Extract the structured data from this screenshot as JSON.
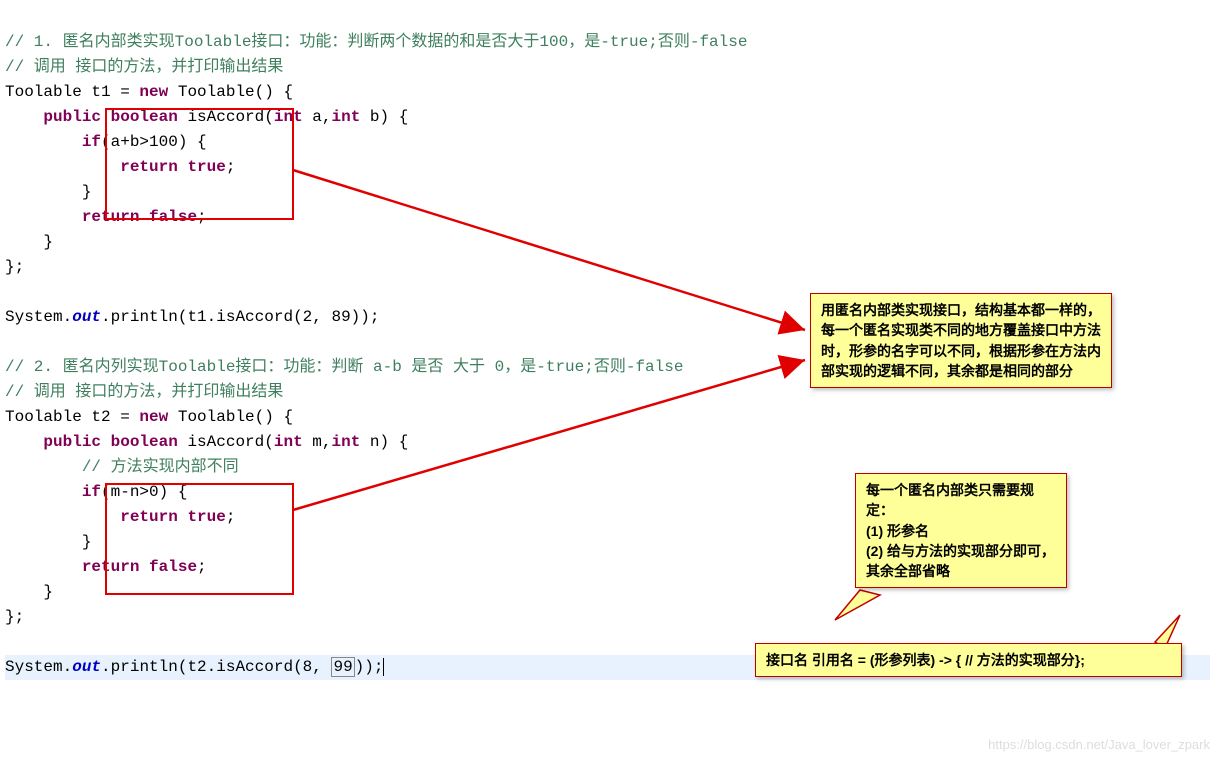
{
  "comments": {
    "c1a": "// 1. 匿名内部类实现Toolable接口：功能：判断两个数据的和是否大于100，是-true;否则-false",
    "c1b": "// 调用 接口的方法，并打印输出结果",
    "c2a": "// 2. 匿名内列实现Toolable接口：功能：判断 a-b 是否 大于 0，是-true;否则-false",
    "c2b": "// 调用 接口的方法，并打印输出结果",
    "c3": "// 方法实现内部不同"
  },
  "code": {
    "t1_decl_pre": "Toolable t1 = ",
    "new_kw": "new",
    "toolable": " Toolable() {",
    "method_sig1_pre": "    ",
    "public": "public",
    "boolean": "boolean",
    "isAccord": " isAccord(",
    "int": "int",
    "a_param": " a,",
    "b_param": " b) {",
    "if1": "if",
    "cond1": "(a+b>100) {",
    "return": "return",
    "true": "true",
    "false": "false",
    "semi": ";",
    "brace_close": "}",
    "brace_close_semi": "};",
    "sys": "System.",
    "out": "out",
    "println_t1": ".println(t1.isAccord(2, 89));",
    "t2_decl_pre": "Toolable t2 = ",
    "m_param": " m,",
    "n_param": " n) {",
    "cond2": "(m-n>0) {",
    "println_t2_pre": ".println(t2.isAccord(8, ",
    "println_t2_num": "99",
    "println_t2_post": "));"
  },
  "callouts": {
    "box1": "用匿名内部类实现接口，结构基本都一样的，每一个匿名实现类不同的地方覆盖接口中方法时，形参的名字可以不同，根据形参在方法内部实现的逻辑不同，其余都是相同的部分",
    "box2": "每一个匿名内部类只需要规定：\n(1) 形参名\n(2) 给与方法的实现部分即可，其余全部省略",
    "box3": "接口名 引用名 = (形参列表) -> { // 方法的实现部分};"
  },
  "watermark": "https://blog.csdn.net/Java_lover_zpark"
}
